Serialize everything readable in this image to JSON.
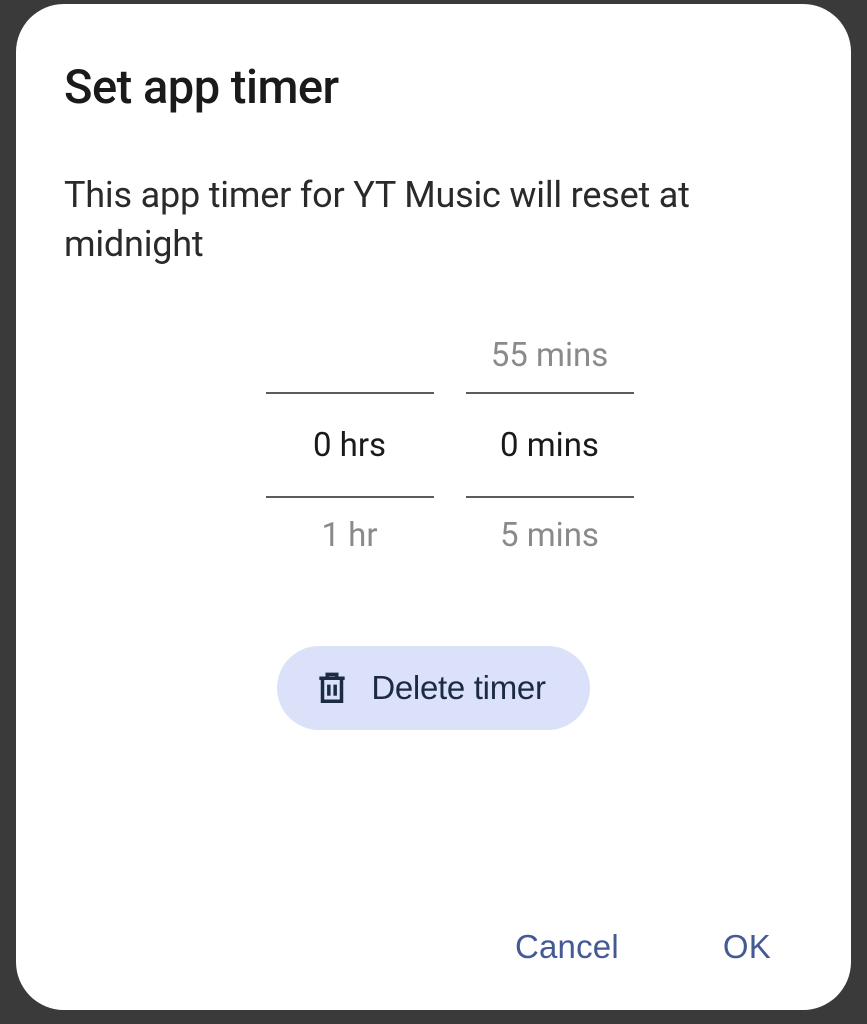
{
  "dialog": {
    "title": "Set app timer",
    "description": "This app timer for YT Music will reset at midnight"
  },
  "picker": {
    "hours": {
      "prev": "",
      "selected": "0 hrs",
      "next": "1 hr"
    },
    "minutes": {
      "prev": "55 mins",
      "selected": "0 mins",
      "next": "5 mins"
    }
  },
  "delete_button": {
    "label": "Delete timer"
  },
  "actions": {
    "cancel": "Cancel",
    "ok": "OK"
  }
}
